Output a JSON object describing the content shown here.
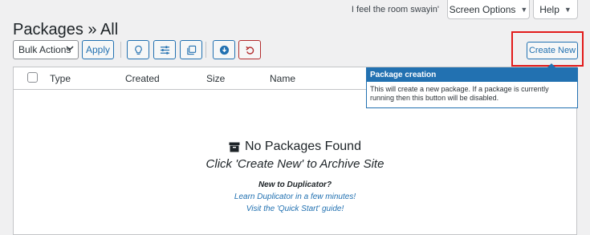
{
  "header": {
    "page_title": "Packages » All",
    "tagline": "I feel the room swayin'",
    "screen_options_label": "Screen Options",
    "help_label": "Help"
  },
  "toolbar": {
    "bulk_actions_value": "Bulk Actions",
    "apply_label": "Apply",
    "create_new_label": "Create New"
  },
  "table": {
    "columns": [
      "Type",
      "Created",
      "Size",
      "Name"
    ]
  },
  "empty_state": {
    "title": "No Packages Found",
    "subtitle": "Click 'Create New' to Archive Site",
    "new_to": "New to Duplicator?",
    "learn_link": "Learn Duplicator in a few minutes!",
    "quick_start_link": "Visit the 'Quick Start' guide!"
  },
  "popover": {
    "title": "Package creation",
    "body": "This will create a new package. If a package is currently running then this button will be disabled."
  },
  "colors": {
    "accent": "#2271b1",
    "danger": "#b32d2e",
    "highlight_box": "#e21b1b"
  }
}
